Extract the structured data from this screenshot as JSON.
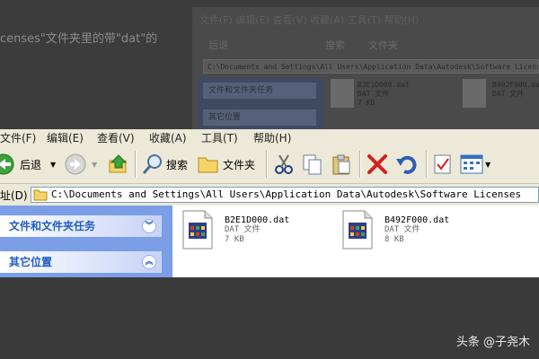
{
  "ghost": {
    "text_fragment": "censes\"文件夹里的带\"dat\"的",
    "menu_fragment": "文件(F)  编辑(E)  查看(V)  收藏(A)  工具(T)  帮助(H)",
    "toolbar_back": "后退",
    "toolbar_search": "搜索",
    "toolbar_folders": "文件夹",
    "address": "C:\\Documents and Settings\\All Users\\Application Data\\Autodesk\\Software Licenses",
    "task1": "文件和文件夹任务",
    "task2": "其它位置",
    "file1_name": "B2E1D000.dat",
    "file1_type": "DAT 文件",
    "file1_size": "7 KB",
    "file2_name": "B492F000.dat",
    "file2_type": "DAT 文件"
  },
  "menu": {
    "file": "文件(F)",
    "edit": "编辑(E)",
    "view": "查看(V)",
    "favorites": "收藏(A)",
    "tools": "工具(T)",
    "help": "帮助(H)"
  },
  "toolbar": {
    "back_label": "后退",
    "search_label": "搜索",
    "folders_label": "文件夹"
  },
  "address": {
    "label": "址(D)",
    "value": "C:\\Documents and Settings\\All Users\\Application Data\\Autodesk\\Software Licenses"
  },
  "sidebar": {
    "tasks_title": "文件和文件夹任务",
    "other_title": "其它位置"
  },
  "files": [
    {
      "name": "B2E1D000.dat",
      "type": "DAT 文件",
      "size": "7 KB"
    },
    {
      "name": "B492F000.dat",
      "type": "DAT 文件",
      "size": "8 KB"
    }
  ],
  "watermark": "头条 @子尧木",
  "colors": {
    "sidebar_bg": "#7b9ee6",
    "task_header_text": "#215dc6",
    "chrome": "#ece9d8"
  }
}
